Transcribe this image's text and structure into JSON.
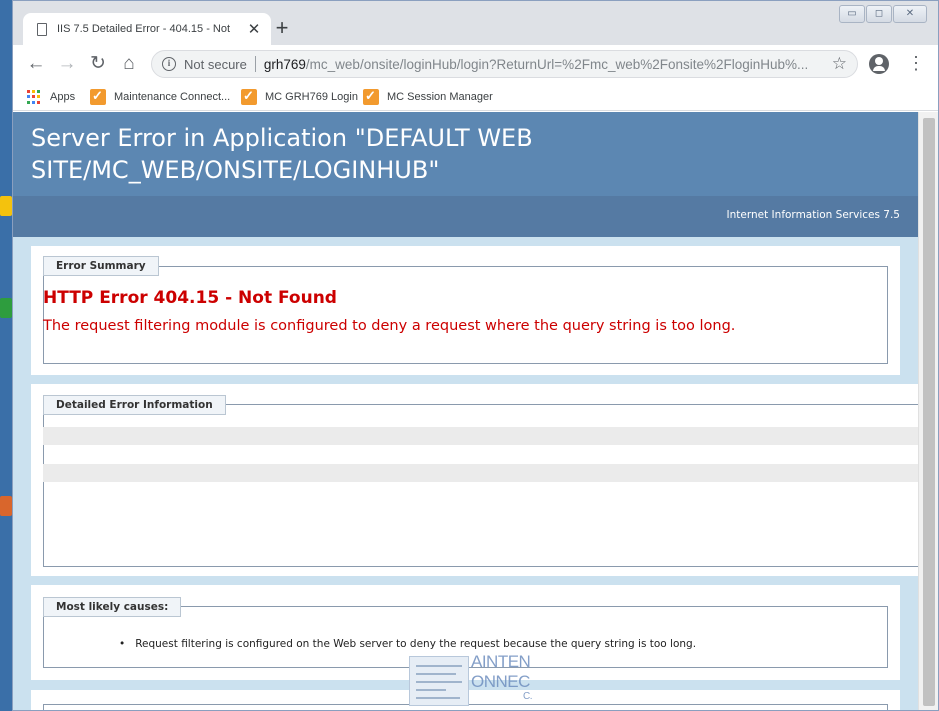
{
  "browser": {
    "tab": {
      "title": "IIS 7.5 Detailed Error - 404.15 - Not",
      "close_glyph": "✕"
    },
    "new_tab_glyph": "+",
    "nav": {
      "back": "←",
      "forward": "→",
      "reload": "↻",
      "home": "⌂"
    },
    "omnibox": {
      "security_label": "Not secure",
      "url_host": "grh769",
      "url_path": "/mc_web/onsite/loginHub/login?ReturnUrl=%2Fmc_web%2Fonsite%2FloginHub%..."
    },
    "menu_glyph": "⋮",
    "star_glyph": "☆",
    "window_controls": {
      "minimize": "▭",
      "maximize": "◻",
      "close": "✕"
    },
    "bookmarks": [
      {
        "label": "Apps",
        "icon": "apps-grid-icon"
      },
      {
        "label": "Maintenance Connect...",
        "icon": "checkmark-favicon-icon"
      },
      {
        "label": "MC GRH769 Login",
        "icon": "checkmark-favicon-icon"
      },
      {
        "label": "MC Session Manager",
        "icon": "checkmark-favicon-icon"
      }
    ]
  },
  "page": {
    "header_title": "Server Error in Application \"DEFAULT WEB SITE/MC_WEB/ONSITE/LOGINHUB\"",
    "server_label": "Internet Information Services 7.5",
    "error_summary": {
      "legend": "Error Summary",
      "title": "HTTP Error 404.15 - Not Found",
      "description": "The request filtering module is configured to deny a request where the query string is too long."
    },
    "detailed_info": {
      "legend": "Detailed Error Information"
    },
    "causes": {
      "legend": "Most likely causes:",
      "items": [
        "Request filtering is configured on the Web server to deny the request because the query string is too long."
      ]
    }
  },
  "watermark": {
    "line1": "AINTEN",
    "line2": "ONNEC",
    "line3": "C."
  },
  "colors": {
    "header_band": "#5c87b2",
    "sub_band": "#557aa3",
    "error_red": "#cc0000",
    "page_background": "#cbe1ef",
    "bookmark_favicon": "#f29a2e"
  }
}
